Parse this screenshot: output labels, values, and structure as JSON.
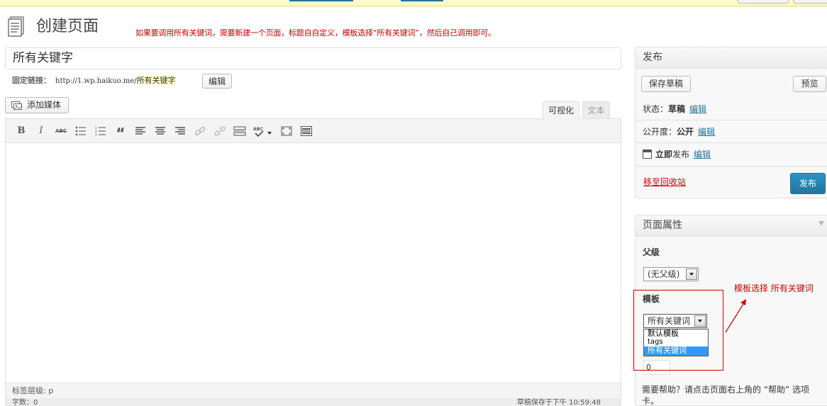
{
  "page": {
    "title": "创建页面",
    "annotation_top": "如果要调用所有关键词，需要新建一个页面，标题自自定义，模板选择“所有关键词”，然后自己调用即可。",
    "annotation_side": "模板选择  所有关键词"
  },
  "editor": {
    "post_title": "所有关键字",
    "permalink_label": "固定链接：",
    "permalink_url": "http://1.wp.haikuo.me/",
    "permalink_slug": "所有关键字",
    "permalink_edit_label": "编辑",
    "add_media_label": "添加媒体",
    "tab_visual": "可视化",
    "tab_text": "文本",
    "toolbar": {
      "bold": "B",
      "italic": "I",
      "strike": "ABC",
      "blockquote": "“",
      "spellcheck": "ABC"
    },
    "status_path": "标签层级: p",
    "word_count": "字数：0",
    "autosave": "草稿保存于下午 10:59:48"
  },
  "publish": {
    "header": "发布",
    "save_draft": "保存草稿",
    "preview": "预览",
    "status_label": "状态：",
    "status_value": "草稿",
    "visibility_label": "公开度：",
    "visibility_value": "公开",
    "schedule_value": "立即",
    "schedule_suffix": "发布",
    "edit_link": "编辑",
    "trash": "移至回收站",
    "publish_button": "发布"
  },
  "attributes": {
    "header": "页面属性",
    "parent_label": "父级",
    "parent_value": "(无父级)",
    "template_label": "模板",
    "template_value": "所有关键词",
    "template_options": [
      "默认模板",
      "tags",
      "所有关键词"
    ],
    "order_value": "0",
    "help_text": "需要帮助？请点击页面右上角的 “帮助” 选项卡。"
  },
  "colors": {
    "annotation": "#cc0000",
    "link": "#21759b",
    "publish_button": "#21759b",
    "selected_option": "#3399ff"
  }
}
